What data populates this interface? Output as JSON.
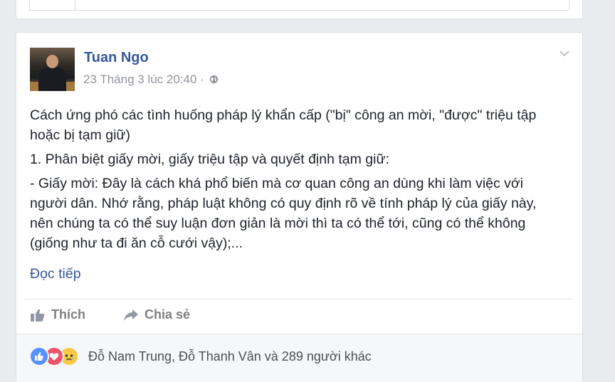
{
  "post": {
    "author": "Tuan Ngo",
    "timestamp": "23 Tháng 3 lúc 20:40 ·",
    "privacy_icon": "globe-icon",
    "paragraphs": [
      "Cách ứng phó các tình huống pháp lý khẩn cấp (\"bị\" công an mời, \"được\" triệu tập hoặc bị tạm giữ)",
      "1. Phân biệt giấy mời, giấy triệu tập và quyết định tạm giữ:",
      "- Giấy mời: Đây là cách khá phổ biến mà cơ quan công an dùng khi làm việc với người dân. Nhớ rằng, pháp luật không có quy định rõ về tính pháp lý của giấy này, nên chúng ta có thể suy luận đơn giản là mời thì ta có thể tới, cũng có thể không (giống như ta đi ăn cỗ cưới vậy);..."
    ],
    "see_more": "Đọc tiếp"
  },
  "actions": {
    "like_label": "Thích",
    "share_label": "Chia sẻ"
  },
  "reactions": {
    "types": [
      "like",
      "love",
      "sad"
    ],
    "names_text": "Đỗ Nam Trung, Đỗ Thanh Vân và 289 người khác"
  },
  "colors": {
    "link": "#365899",
    "meta": "#90949c",
    "background": "#e9ebee"
  }
}
